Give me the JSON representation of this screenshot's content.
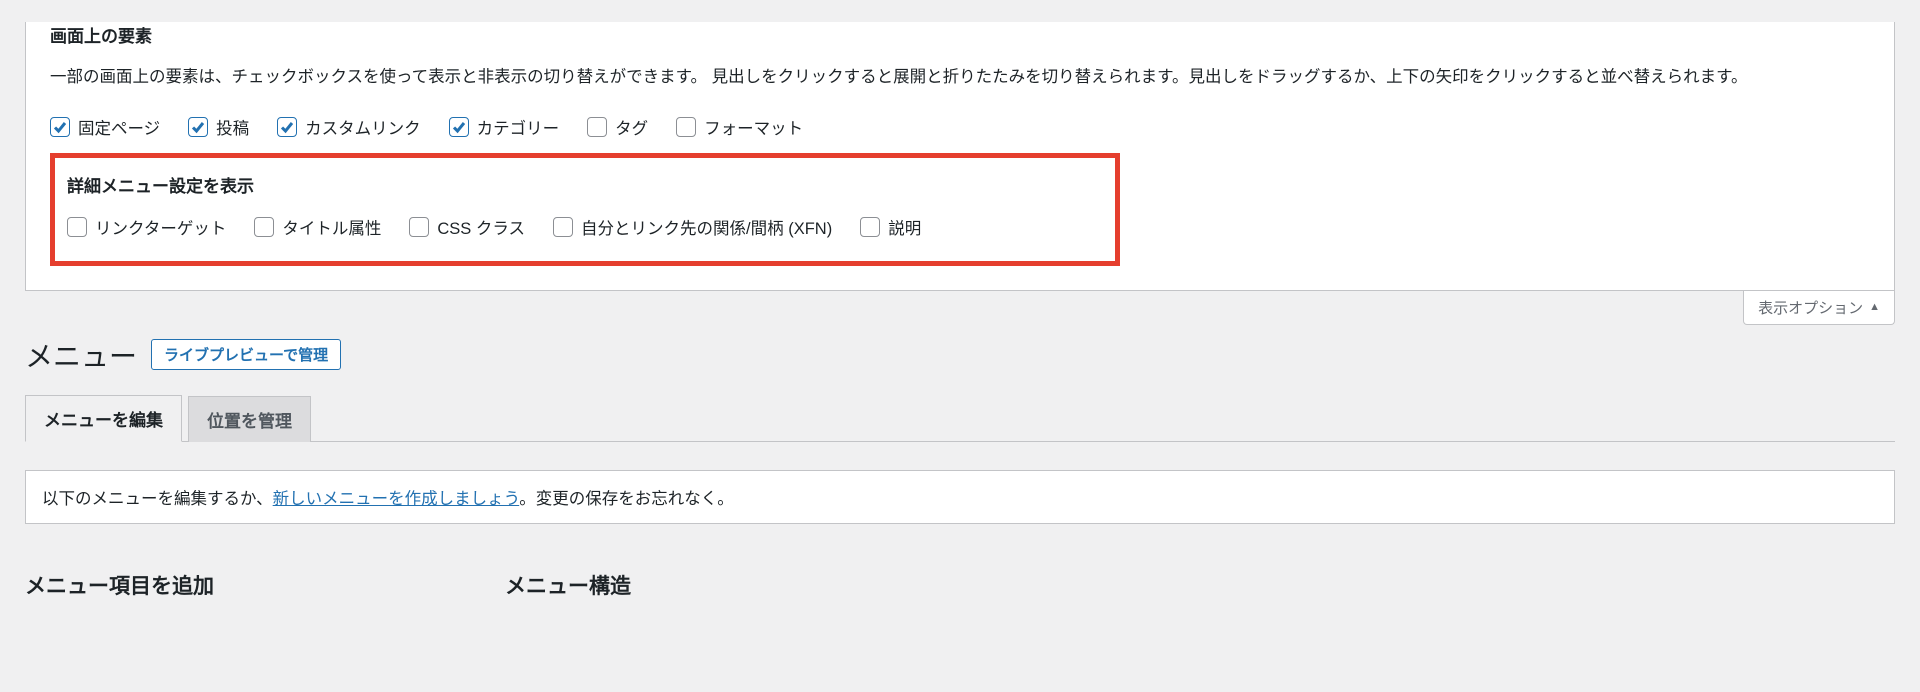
{
  "screen_options": {
    "elements_heading": "画面上の要素",
    "elements_description": "一部の画面上の要素は、チェックボックスを使って表示と非表示の切り替えができます。 見出しをクリックすると展開と折りたたみを切り替えられます。見出しをドラッグするか、上下の矢印をクリックすると並べ替えられます。",
    "element_checkboxes": [
      {
        "label": "固定ページ",
        "checked": true
      },
      {
        "label": "投稿",
        "checked": true
      },
      {
        "label": "カスタムリンク",
        "checked": true
      },
      {
        "label": "カテゴリー",
        "checked": true
      },
      {
        "label": "タグ",
        "checked": false
      },
      {
        "label": "フォーマット",
        "checked": false
      }
    ],
    "advanced_heading": "詳細メニュー設定を表示",
    "advanced_checkboxes": [
      {
        "label": "リンクターゲット",
        "checked": false
      },
      {
        "label": "タイトル属性",
        "checked": false
      },
      {
        "label": "CSS クラス",
        "checked": false
      },
      {
        "label": "自分とリンク先の関係/間柄 (XFN)",
        "checked": false
      },
      {
        "label": "説明",
        "checked": false
      }
    ],
    "toggle_label": "表示オプション"
  },
  "page_title": "メニュー",
  "live_preview_button": "ライブプレビューで管理",
  "tabs": {
    "edit": "メニューを編集",
    "locations": "位置を管理"
  },
  "instruction": {
    "prefix": "以下のメニューを編集するか、",
    "link": "新しいメニューを作成しましょう",
    "suffix": "。変更の保存をお忘れなく。"
  },
  "columns": {
    "add_items": "メニュー項目を追加",
    "structure": "メニュー構造"
  }
}
